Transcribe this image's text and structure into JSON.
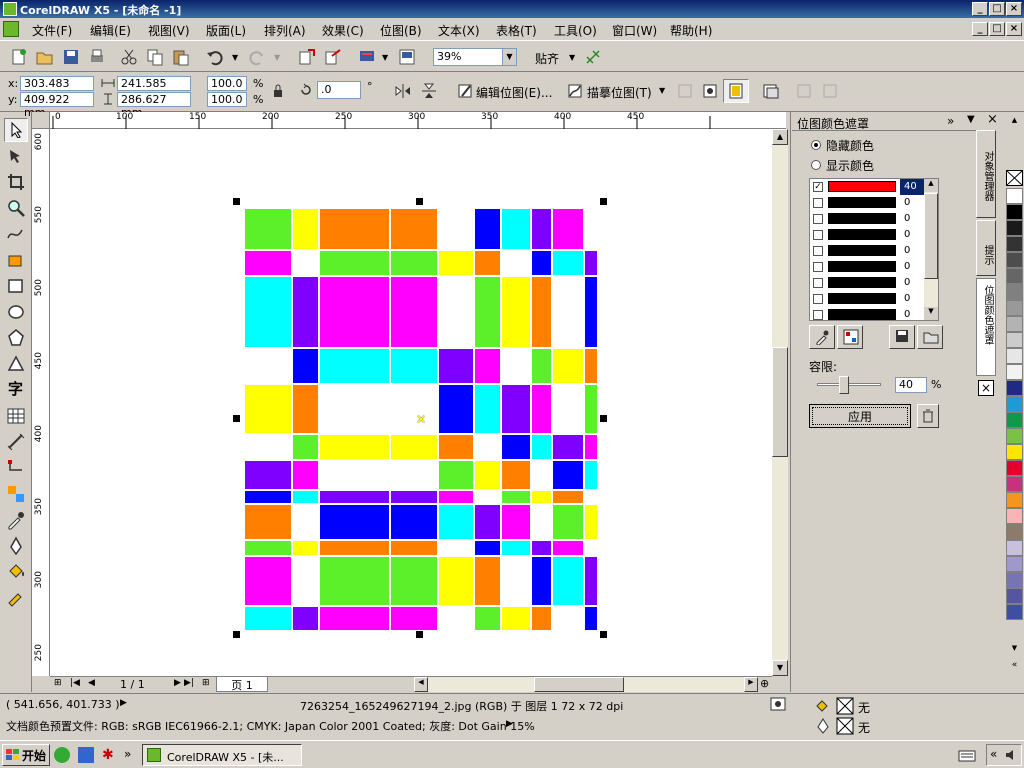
{
  "window": {
    "title": "CorelDRAW X5 - [未命名 -1]"
  },
  "menu": [
    "文件(F)",
    "编辑(E)",
    "视图(V)",
    "版面(L)",
    "排列(A)",
    "效果(C)",
    "位图(B)",
    "文本(X)",
    "表格(T)",
    "工具(O)",
    "窗口(W)",
    "帮助(H)"
  ],
  "toolbar": {
    "zoom": "39%",
    "snap_label": "贴齐"
  },
  "property": {
    "x_label": "x:",
    "x": "303.483 mm",
    "y_label": "y:",
    "y": "409.922 mm",
    "w": "241.585 mm",
    "h": "286.627 mm",
    "scale_w": "100.0",
    "scale_h": "100.0",
    "pct": "%",
    "rotation": ".0",
    "deg": "°",
    "edit_bitmap": "编辑位图(E)...",
    "trace_bitmap": "描摹位图(T)"
  },
  "rulers": {
    "top": [
      "0",
      "100",
      "150",
      "200",
      "250",
      "300",
      "350",
      "400",
      "450"
    ],
    "left": [
      "600",
      "550",
      "500",
      "450",
      "400",
      "350",
      "300",
      "250"
    ]
  },
  "pagebar": {
    "page_count": "1 / 1",
    "page_tab": "页 1"
  },
  "status": {
    "coords": "( 541.656, 401.733 )",
    "object_info": "7263254_165249627194_2.jpg (RGB) 于 图层 1 72 x 72 dpi",
    "color_profiles": "文档颜色预置文件: RGB: sRGB IEC61966-2.1; CMYK: Japan Color 2001 Coated; 灰度: Dot Gain 15%",
    "fill_none": "无",
    "outline_none": "无"
  },
  "docker": {
    "title": "位图颜色遮罩",
    "hide_colors": "隐藏颜色",
    "show_colors": "显示颜色",
    "tolerance_label": "容限:",
    "tolerance_value": "40",
    "tolerance_pct": "%",
    "apply_label": "应用",
    "side_tab_1": "对象管理器",
    "side_tab_2": "提示",
    "side_tab_3": "位图颜色遮罩",
    "mask_rows": [
      {
        "checked": true,
        "color": "#ff0000",
        "value": "40"
      },
      {
        "checked": false,
        "color": "#000000",
        "value": "0"
      },
      {
        "checked": false,
        "color": "#000000",
        "value": "0"
      },
      {
        "checked": false,
        "color": "#000000",
        "value": "0"
      },
      {
        "checked": false,
        "color": "#000000",
        "value": "0"
      },
      {
        "checked": false,
        "color": "#000000",
        "value": "0"
      },
      {
        "checked": false,
        "color": "#000000",
        "value": "0"
      },
      {
        "checked": false,
        "color": "#000000",
        "value": "0"
      },
      {
        "checked": false,
        "color": "#000000",
        "value": "0"
      }
    ]
  },
  "palette_colors": [
    "#ffffff",
    "#000000",
    "#1a1a1a",
    "#333333",
    "#4d4d4d",
    "#666666",
    "#808080",
    "#999999",
    "#b3b3b3",
    "#cccccc",
    "#e6e6e6",
    "#f2f2f2",
    "#1f2a85",
    "#1e9ad6",
    "#0e9a48",
    "#7cc242",
    "#ffe600",
    "#e4002b",
    "#c8317c",
    "#f7941d",
    "#f9b4b4",
    "#8c7b6b",
    "#c7c1dd",
    "#9f99c9",
    "#7575b3",
    "#5555a0",
    "#3d4f9f"
  ],
  "taskbar": {
    "start": "开始",
    "task": "CorelDRAW X5 - [未..."
  },
  "colors": {
    "title_bg": "#0a246a",
    "accent": "#0a246a"
  }
}
